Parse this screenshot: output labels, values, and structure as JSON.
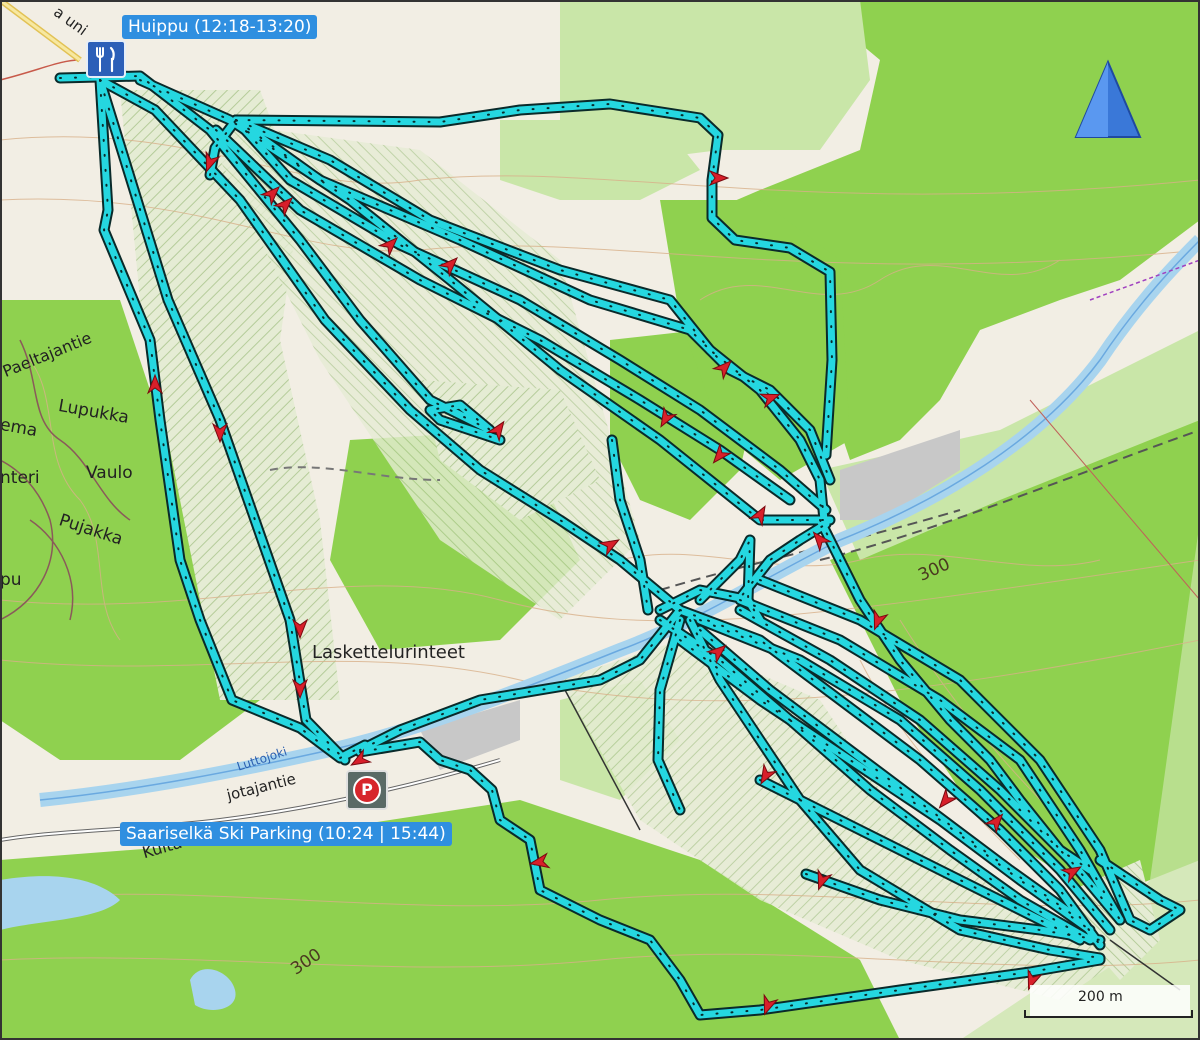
{
  "map": {
    "colors": {
      "background": "#f2eee4",
      "forest": "#8fd14f",
      "forest_light": "#c9e6a8",
      "track": "#25d7e0",
      "track_outline": "#0a2a2a",
      "arrow": "#d81f2a",
      "water": "#a8d4ee",
      "north_arrow": "#3a78d8"
    },
    "waypoints": {
      "summit": "Huippu (12:18-13:20)",
      "parking": "Saariselkä Ski Parking (10:24 | 15:44)"
    },
    "icons": {
      "summit": "restaurant-icon",
      "parking": "parking-icon",
      "north": "north-arrow-icon"
    },
    "place_labels": {
      "slopes": "Laskettelurinteet",
      "stream": "Luttojoki",
      "road1": "Paeltajantie",
      "lupukka": "Lupukka",
      "vaulo": "Vaulo",
      "pujakka": "Pujakka",
      "enteri": "nteri",
      "ema": "ema",
      "pu": "pu",
      "kulta": "Kulta",
      "jotajantie": "jotajantie",
      "top_road": "a uni"
    },
    "contours": {
      "c1": "300",
      "c2": "300"
    },
    "scale": "200 m"
  }
}
